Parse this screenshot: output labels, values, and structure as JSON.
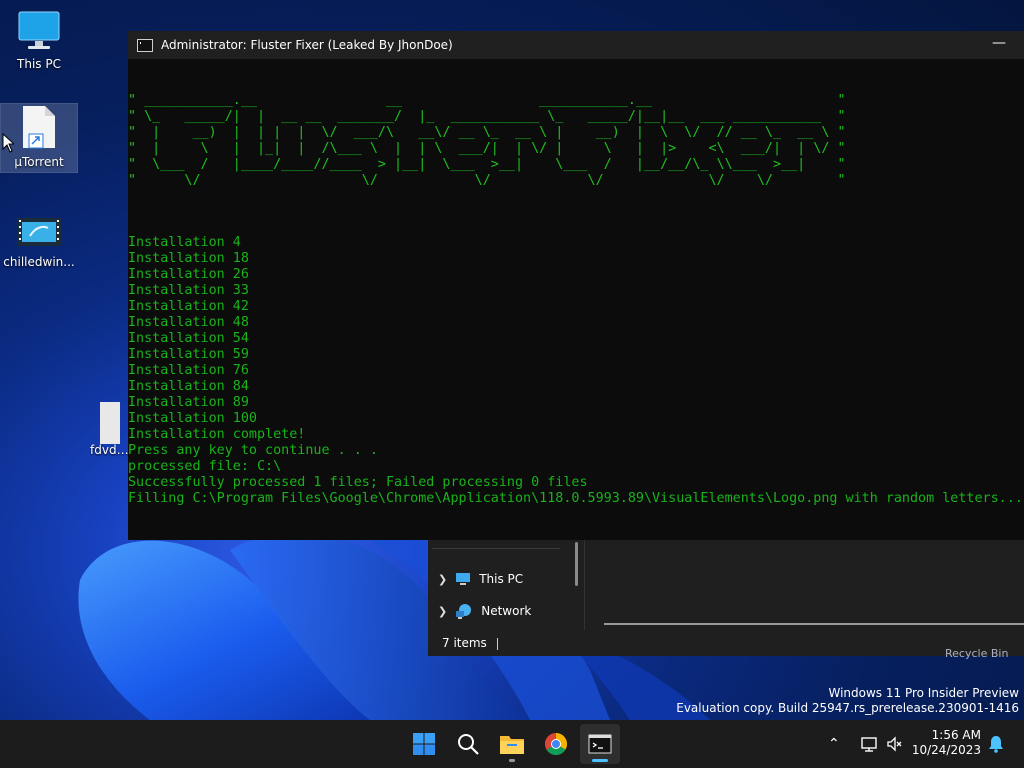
{
  "desktop": {
    "icons": [
      {
        "label": "This PC",
        "icon": "monitor-icon"
      },
      {
        "label": "μTorrent",
        "icon": "file-shortcut-icon"
      },
      {
        "label": "chilledwin...",
        "icon": "video-file-icon"
      },
      {
        "label": "fdvdvc",
        "icon": "file-icon"
      }
    ]
  },
  "console": {
    "title": "Administrator:  Fluster Fixer (Leaked By JhonDoe)",
    "ascii_banner": "\" ___________.__                __                 ___________.__                       \"\n\" \\_   _____/|  |  __ __  _______/  |_  ___________ \\_   _____/|__|__  ___ ___________  \"\n\"  |    __)  |  | |  |  \\/  ___/\\   __\\/ __ \\_  __ \\ |    __)  |  \\  \\/  // __ \\_  __ \\ \"\n\"  |     \\   |  |_|  |  /\\___ \\  |  | \\  ___/|  | \\/ |     \\   |  |>    <\\  ___/|  | \\/ \"\n\"  \\___  /   |____/____//____  > |__|  \\___  >__|    \\___  /   |__/__/\\_ \\\\___  >__|    \"\n\"      \\/                    \\/            \\/            \\/             \\/    \\/        \"",
    "output_lines": [
      "Installation 4",
      "Installation 18",
      "Installation 26",
      "Installation 33",
      "Installation 42",
      "Installation 48",
      "Installation 54",
      "Installation 59",
      "Installation 76",
      "Installation 84",
      "Installation 89",
      "Installation 100",
      "Installation complete!",
      "Press any key to continue . . .",
      "processed file: C:\\",
      "Successfully processed 1 files; Failed processing 0 files",
      "Filling C:\\Program Files\\Google\\Chrome\\Application\\118.0.5993.89\\VisualElements\\Logo.png with random letters..."
    ],
    "text_color": "#19b21b"
  },
  "explorer": {
    "nav_items": [
      {
        "label": "This PC",
        "icon": "monitor-icon"
      },
      {
        "label": "Network",
        "icon": "network-icon"
      }
    ],
    "status": "7 items"
  },
  "watermark": {
    "line1": "Windows 11 Pro Insider Preview",
    "line2": "Evaluation copy. Build 25947.rs_prerelease.230901-1416",
    "recycle": "Recycle Bin"
  },
  "taskbar": {
    "apps": [
      {
        "name": "Start",
        "icon": "windows-logo-icon"
      },
      {
        "name": "Search",
        "icon": "search-icon"
      },
      {
        "name": "File Explorer",
        "icon": "folder-icon"
      },
      {
        "name": "Google Chrome",
        "icon": "chrome-icon"
      },
      {
        "name": "Terminal",
        "icon": "terminal-icon"
      }
    ],
    "time": "1:56 AM",
    "date": "10/24/2023"
  }
}
